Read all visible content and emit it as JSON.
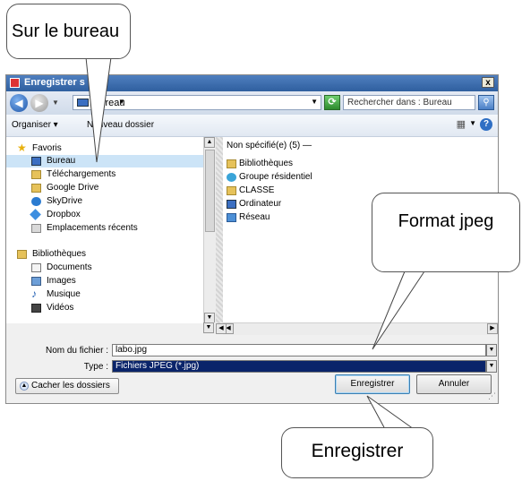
{
  "dialog": {
    "title": "Enregistrer s",
    "close": "x",
    "address": {
      "crumb": "Bureau",
      "search_placeholder": "Rechercher dans : Bureau"
    },
    "toolbar": {
      "organize": "Organiser",
      "new_folder": "Nouveau dossier"
    },
    "nav": {
      "favorites": "Favoris",
      "items": [
        "Bureau",
        "Téléchargements",
        "Google Drive",
        "SkyDrive",
        "Dropbox",
        "Emplacements récents"
      ],
      "libraries": "Bibliothèques",
      "library_items": [
        "Documents",
        "Images",
        "Musique",
        "Vidéos"
      ]
    },
    "files": {
      "group": "Non spécifié(e) (5) —",
      "items": [
        "Bibliothèques",
        "Groupe résidentiel",
        "CLASSE",
        "Ordinateur",
        "Réseau"
      ]
    },
    "filename_label": "Nom du fichier :",
    "filename_value": "labo.jpg",
    "type_label": "Type :",
    "type_value": "Fichiers JPEG (*.jpg)",
    "hide_folders": "Cacher les dossiers",
    "save": "Enregistrer",
    "cancel": "Annuler"
  },
  "callouts": {
    "desktop": "Sur le bureau",
    "format": "Format jpeg",
    "save": "Enregistrer"
  },
  "colors": {
    "selection": "#0a246a",
    "nav_selected": "#cce4f7",
    "title_bar": "#2f5f9f"
  }
}
